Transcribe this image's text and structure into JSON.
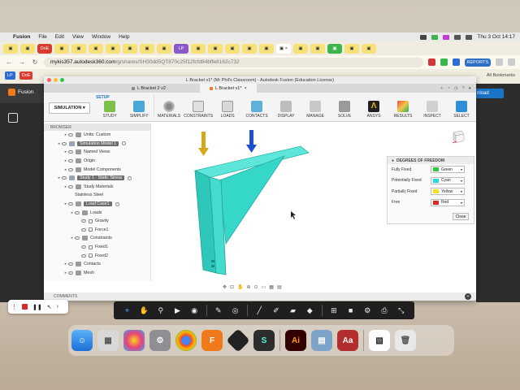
{
  "menubar": {
    "app_name": "Fusion",
    "items": [
      "File",
      "Edit",
      "View",
      "Window",
      "Help"
    ],
    "clock": "Thu 3 Oct  14:17"
  },
  "chrome": {
    "tabs": [
      "DoE",
      "LP"
    ],
    "address": {
      "domain": "mykis357.autodesk360.com",
      "path": "/g/shares/SH30dd5QT870c25f12fcfd84bffe8162c732"
    },
    "reports_label": "REPORTS",
    "bookmarks": [
      "LP",
      "DoE"
    ],
    "all_bookmarks": "All Bookmarks"
  },
  "fusion": {
    "window_title": "L Bracket v1* (Mr Phil's Classroom) - Autodesk Fusion (Education License)",
    "tabs": [
      {
        "label": "L Bracket 2 v2",
        "active": false
      },
      {
        "label": "L Bracket v1*",
        "active": true
      }
    ],
    "left_label": "Fusion",
    "download_label": "nload",
    "workspace": "SIMULATION",
    "setup_tab": "SETUP",
    "ribbon": [
      "STUDY",
      "SIMPLIFY",
      "MATERIALS",
      "CONSTRAINTS",
      "LOADS",
      "CONTACTS",
      "DISPLAY",
      "MANAGE",
      "SOLVE",
      "ANSYS",
      "RESULTS",
      "INSPECT",
      "SELECT"
    ],
    "browser": {
      "header": "BROWSER",
      "rows": [
        {
          "text": "Units: Custom",
          "indent": 2,
          "icon": "folder",
          "hl": false
        },
        {
          "text": "Simulation Model 1",
          "indent": 1,
          "icon": "model",
          "hl": true
        },
        {
          "text": "Named Views",
          "indent": 2,
          "icon": "folder",
          "hl": false
        },
        {
          "text": "Origin",
          "indent": 2,
          "icon": "folder",
          "hl": false
        },
        {
          "text": "Model Components",
          "indent": 2,
          "icon": "folder",
          "hl": false
        },
        {
          "text": "Study 1 - Static Stress",
          "indent": 1,
          "icon": "study",
          "hl": true
        },
        {
          "text": "Study Materials",
          "indent": 2,
          "icon": "folder",
          "hl": false
        },
        {
          "text": "Stainless Steel",
          "indent": 3,
          "icon": "none",
          "hl": false
        },
        {
          "text": "Load Case1",
          "indent": 2,
          "icon": "folder",
          "hl": true
        },
        {
          "text": "Loads",
          "indent": 3,
          "icon": "folder",
          "hl": false
        },
        {
          "text": "Gravity",
          "indent": 4,
          "icon": "check",
          "hl": false
        },
        {
          "text": "Force1",
          "indent": 4,
          "icon": "check",
          "hl": false
        },
        {
          "text": "Constraints",
          "indent": 3,
          "icon": "folder",
          "hl": false
        },
        {
          "text": "Fixed1",
          "indent": 4,
          "icon": "check",
          "hl": false
        },
        {
          "text": "Fixed2",
          "indent": 4,
          "icon": "check",
          "hl": false
        },
        {
          "text": "Contacts",
          "indent": 2,
          "icon": "folder",
          "hl": false
        },
        {
          "text": "Mesh",
          "indent": 2,
          "icon": "folder",
          "hl": false
        }
      ]
    },
    "dof": {
      "title": "DEGREES OF FREEDOM",
      "rows": [
        {
          "label": "Fully Fixed",
          "value": "Green",
          "color": "#2ecc40"
        },
        {
          "label": "Potentially Fixed",
          "value": "Cyan",
          "color": "#23d8e6"
        },
        {
          "label": "Partially Fixed",
          "value": "Yellow",
          "color": "#f2e316"
        },
        {
          "label": "Free",
          "value": "Red",
          "color": "#e0261f"
        }
      ],
      "close_label": "Close"
    },
    "comments_label": "COMMENTS"
  },
  "colors": {
    "model": "#35d7c9",
    "arrow_gold": "#d6a719",
    "arrow_blue": "#1f4fd1",
    "accent": "#1a74c6"
  }
}
